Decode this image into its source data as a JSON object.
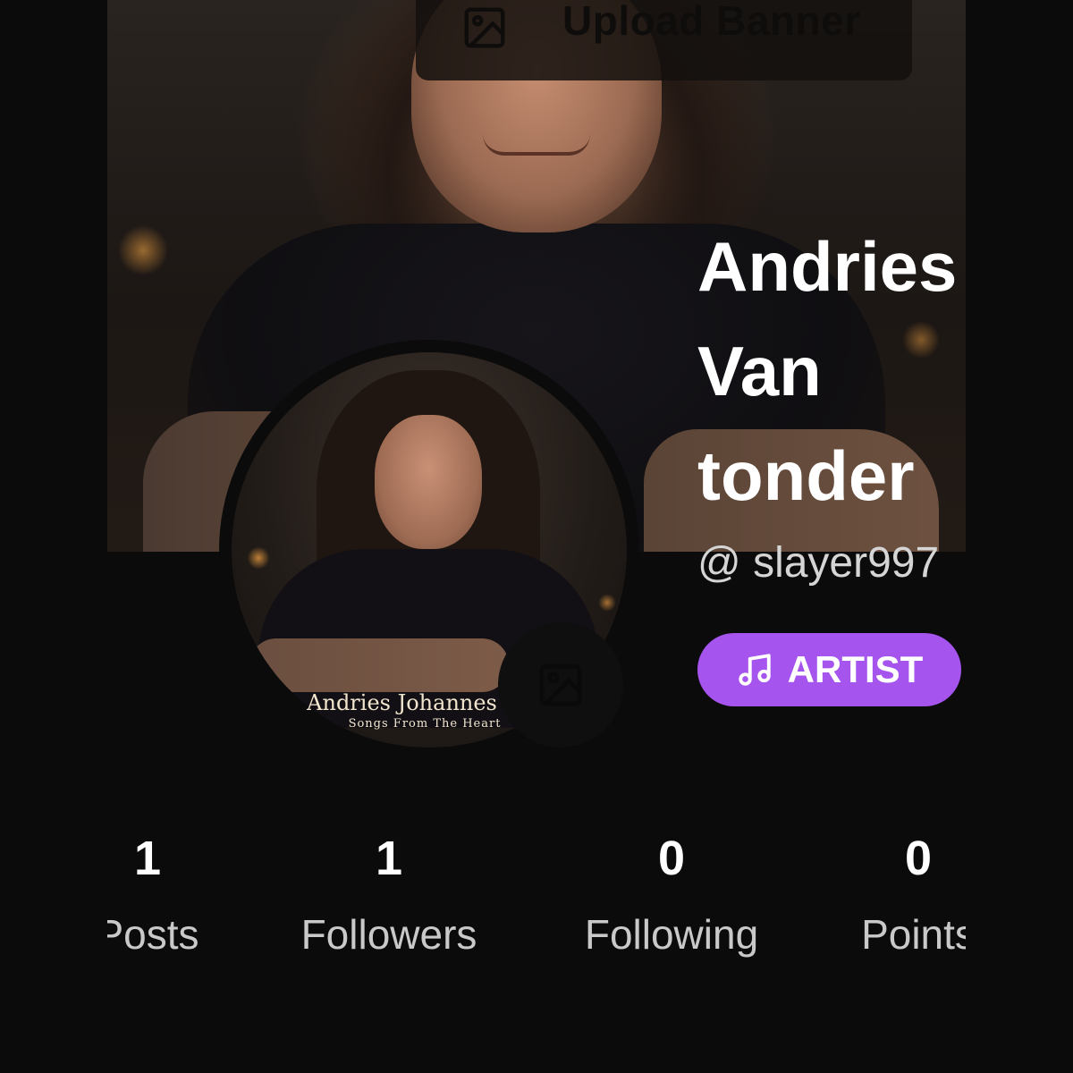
{
  "banner": {
    "upload_label": "Upload Banner",
    "upload_icon": "image-icon"
  },
  "profile": {
    "name_lines": [
      "Andries",
      "Van",
      "tonder"
    ],
    "handle": "@ slayer997",
    "role_badge": "ARTIST",
    "role_icon": "music-note-icon",
    "avatar_caption_line1": "Andries Johannes van",
    "avatar_caption_line2": "Songs From The Heart",
    "avatar_upload_icon": "image-icon"
  },
  "stats": [
    {
      "value": "1",
      "label": "Posts"
    },
    {
      "value": "1",
      "label": "Followers"
    },
    {
      "value": "0",
      "label": "Following"
    },
    {
      "value": "0",
      "label": "Points"
    }
  ],
  "colors": {
    "background": "#0b0b0c",
    "accent": "#a554ee",
    "text_primary": "#ffffff",
    "text_secondary": "#c9c9c9"
  }
}
